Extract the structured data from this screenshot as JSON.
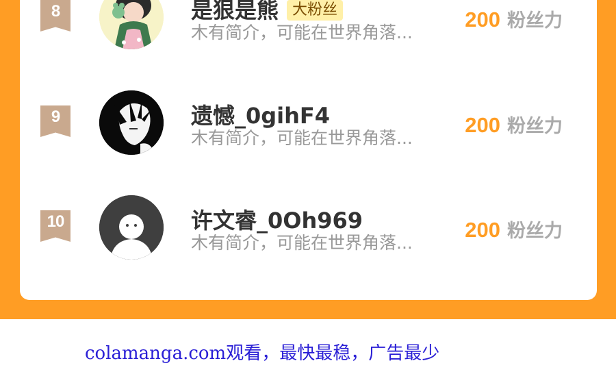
{
  "colors": {
    "accent_orange": "#ff9d24",
    "rank_badge": "#c9a98e",
    "fan_tag_bg": "#fff0a8",
    "footer_link": "#2a1fd6"
  },
  "rows": [
    {
      "rank": "8",
      "avatar": "anime-girl-avatar",
      "name": "是狠是熊",
      "tag": "大粉丝",
      "intro": "木有简介，可能在世界角落...",
      "power_value": "200",
      "power_label": "粉丝力"
    },
    {
      "rank": "9",
      "avatar": "dark-hair-sketch-avatar",
      "name": "遗憾_0gihF4",
      "tag": "",
      "intro": "木有简介，可能在世界角落...",
      "power_value": "200",
      "power_label": "粉丝力"
    },
    {
      "rank": "10",
      "avatar": "default-ghost-avatar",
      "name": "许文睿_0Oh969",
      "tag": "",
      "intro": "木有简介，可能在世界角落...",
      "power_value": "200",
      "power_label": "粉丝力"
    }
  ],
  "footer": {
    "text": "colamanga.com观看，最快最稳，广告最少"
  }
}
